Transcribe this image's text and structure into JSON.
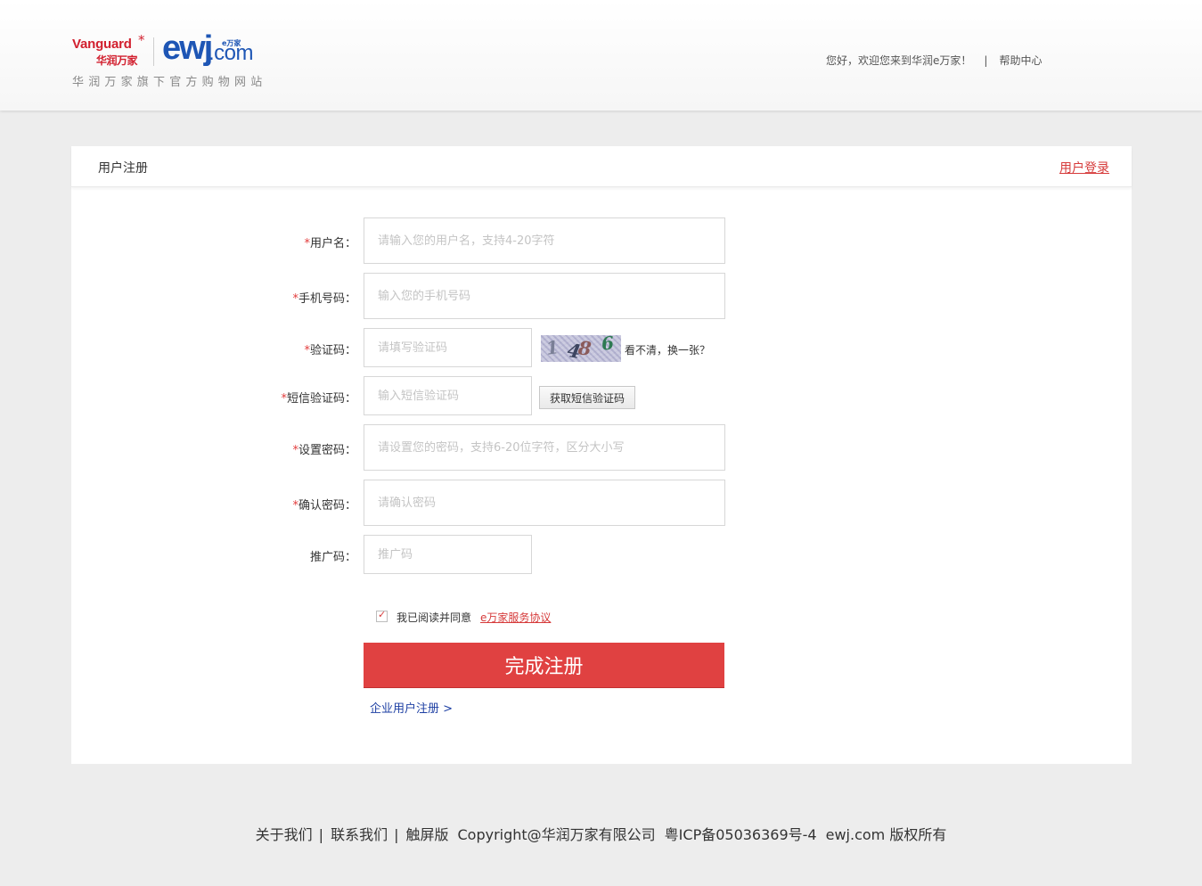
{
  "header": {
    "logo_vanguard_en": "Vanguard",
    "logo_vanguard_star": "*",
    "logo_vanguard_cn": "华润万家",
    "logo_ewj_main": "ewj",
    "logo_ewj_dotcom": ".com",
    "logo_ewj_cn": "e万家",
    "tagline": "华润万家旗下官方购物网站",
    "welcome": "您好，欢迎您来到华润e万家！",
    "separator": "|",
    "help_center": "帮助中心"
  },
  "card": {
    "title": "用户注册",
    "login_link": "用户登录"
  },
  "form": {
    "required_mark": "*",
    "username": {
      "label": "用户名：",
      "placeholder": "请输入您的用户名，支持4-20字符",
      "value": ""
    },
    "phone": {
      "label": "手机号码：",
      "placeholder": "输入您的手机号码",
      "value": ""
    },
    "captcha": {
      "label": "验证码：",
      "placeholder": "请填写验证码",
      "value": "",
      "image_text": [
        "1",
        "4",
        "8",
        "6"
      ],
      "refresh": "看不清，换一张？"
    },
    "sms": {
      "label": "短信验证码：",
      "placeholder": "输入短信验证码",
      "value": "",
      "button": "获取短信验证码"
    },
    "password": {
      "label": "设置密码：",
      "placeholder": "请设置您的密码，支持6-20位字符，区分大小写",
      "value": ""
    },
    "confirm": {
      "label": "确认密码：",
      "placeholder": "请确认密码",
      "value": ""
    },
    "promo": {
      "label": "推广码：",
      "placeholder": "推广码",
      "value": ""
    },
    "agree_checked": true,
    "agree_text": "我已阅读并同意",
    "agree_link": "e万家服务协议",
    "submit": "完成注册",
    "enterprise_link": "企业用户注册 >"
  },
  "footer": {
    "about": "关于我们",
    "contact": "联系我们",
    "touch": "触屏版",
    "sep": "|",
    "copyright": "Copyright@华润万家有限公司",
    "icp": "粤ICP备05036369号-4",
    "rights": "ewj.com 版权所有"
  },
  "colors": {
    "accent_red": "#e04141",
    "brand_blue": "#1e56b5",
    "link_blue": "#1d3fa3",
    "page_bg": "#ededed"
  }
}
